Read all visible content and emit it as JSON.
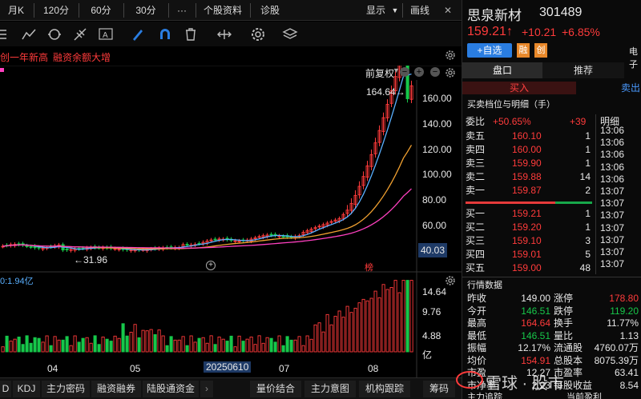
{
  "topbar": {
    "period_label": "月K",
    "periods": [
      "120分",
      "60分",
      "30分"
    ],
    "more": "···",
    "info_tabs": [
      "个股资料",
      "诊股"
    ],
    "display": "显示",
    "draw": "画线"
  },
  "signals": [
    "创一年新高",
    "融资余额大增"
  ],
  "adjust_label": "前复权",
  "chart": {
    "high_label": "164.64→",
    "low_label": "←31.96",
    "price_label": "40.03",
    "price_ticks": [
      "160.00",
      "140.00",
      "120.00",
      "100.00",
      "80.00",
      "60.00"
    ],
    "volume_label": "0:1.94亿",
    "vol_ticks": [
      "14.64",
      "9.76",
      "4.88",
      "亿"
    ],
    "x_labels": [
      "04",
      "05",
      "20250610",
      "07",
      "08"
    ],
    "rank_badge": "榜"
  },
  "bottom_tabs": [
    "D",
    "KDJ",
    "主力密码",
    "融资融券",
    "陆股通资金",
    "量价结合",
    "主力意图",
    "机构跟踪",
    "筹码"
  ],
  "stock": {
    "name": "思泉新材",
    "code": "301489",
    "price": "159.21↑",
    "change": "+10.21",
    "pct": "+6.85%",
    "add_watch": "+自选",
    "tag1": "融",
    "tag2": "创",
    "tag3": "电子"
  },
  "panel_tabs": [
    "盘口",
    "推荐"
  ],
  "buy_label": "买入",
  "sell_label": "卖出",
  "section_title": "买卖档位与明细（手）",
  "weibi": {
    "label": "委比",
    "value": "+50.65%",
    "diff": "+39",
    "detail": "明细"
  },
  "asks": [
    {
      "label": "卖五",
      "price": "160.10",
      "vol": "1"
    },
    {
      "label": "卖四",
      "price": "160.00",
      "vol": "1"
    },
    {
      "label": "卖三",
      "price": "159.90",
      "vol": "1"
    },
    {
      "label": "卖二",
      "price": "159.88",
      "vol": "14"
    },
    {
      "label": "卖一",
      "price": "159.87",
      "vol": "2"
    }
  ],
  "bids": [
    {
      "label": "买一",
      "price": "159.21",
      "vol": "1"
    },
    {
      "label": "买二",
      "price": "159.20",
      "vol": "1"
    },
    {
      "label": "买三",
      "price": "159.10",
      "vol": "3"
    },
    {
      "label": "买四",
      "price": "159.01",
      "vol": "5"
    },
    {
      "label": "买五",
      "price": "159.00",
      "vol": "48"
    }
  ],
  "times": [
    "13:06",
    "13:06",
    "13:06",
    "13:06",
    "13:06",
    "13:07",
    "13:07",
    "13:07",
    "13:07",
    "13:07",
    "13:07",
    "13:07"
  ],
  "quote_title": "行情数据",
  "quote": [
    {
      "l1": "昨收",
      "v1": "149.00",
      "c1": "white",
      "l2": "涨停",
      "v2": "178.80",
      "c2": "red"
    },
    {
      "l1": "今开",
      "v1": "146.51",
      "c1": "green",
      "l2": "跌停",
      "v2": "119.20",
      "c2": "green"
    },
    {
      "l1": "最高",
      "v1": "164.64",
      "c1": "red",
      "l2": "换手",
      "v2": "11.77%",
      "c2": "white"
    },
    {
      "l1": "最低",
      "v1": "146.51",
      "c1": "green",
      "l2": "量比",
      "v2": "1.13",
      "c2": "white"
    },
    {
      "l1": "振幅",
      "v1": "12.17%",
      "c1": "white",
      "l2": "流通股",
      "v2": "4760.07万",
      "c2": "white"
    },
    {
      "l1": "均价",
      "v1": "154.91",
      "c1": "red",
      "l2": "总股本",
      "v2": "8075.39万",
      "c2": "white"
    },
    {
      "l1": "市盈",
      "v1": "12.27",
      "c1": "white",
      "l2": "市盈率",
      "v2": "63.41",
      "c2": "white"
    },
    {
      "l1": "市净率",
      "v1": "2.23",
      "c1": "white",
      "l2": "每股收益",
      "v2": "8.54",
      "c2": "white"
    }
  ],
  "footer_label": "主力追踪",
  "footer_label2": "当前盈利",
  "watermark": "雪球 · 股市",
  "colors": {
    "up": "#ff3b3b",
    "down": "#17c74a",
    "ma5": "#ffffff",
    "ma10": "#f0a030",
    "ma20": "#ff40c0",
    "accent": "#2a7de1"
  }
}
